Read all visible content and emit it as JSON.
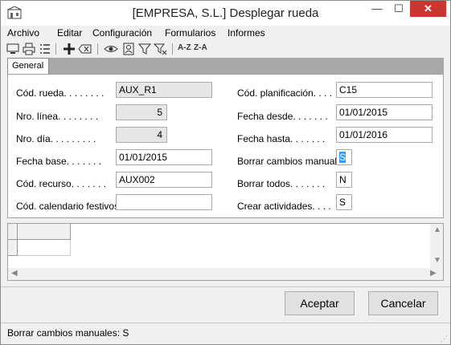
{
  "window": {
    "title": "[EMPRESA, S.L.] Desplegar rueda"
  },
  "titlebar_buttons": {
    "minimize": "—",
    "maximize": "☐",
    "close": "✕"
  },
  "menu": [
    "Archivo",
    "Editar",
    "Configuración",
    "Formularios",
    "Informes"
  ],
  "toolbar": {
    "sort_asc": "A-Z",
    "sort_desc": "Z-A"
  },
  "tabs": [
    "General"
  ],
  "form_left": [
    {
      "label": "Cód. rueda. . . . . . . .",
      "value": "AUX_R1",
      "readonly": true,
      "align": "left"
    },
    {
      "label": "Nro. línea. . . . . . . .",
      "value": "5",
      "readonly": true,
      "align": "right"
    },
    {
      "label": "Nro. día. . . . . . . . .",
      "value": "4",
      "readonly": true,
      "align": "right"
    },
    {
      "label": "Fecha base. . . . . . .",
      "value": "01/01/2015",
      "readonly": false,
      "align": "left"
    },
    {
      "label": "Cód. recurso. . . . . . .",
      "value": "AUX002",
      "readonly": false,
      "align": "left"
    },
    {
      "label": "Cód. calendario festivos.",
      "value": "",
      "readonly": false,
      "align": "left"
    }
  ],
  "form_right": [
    {
      "label": "Cód. planificación. . . .",
      "value": "C15"
    },
    {
      "label": "Fecha desde. . . . . . .",
      "value": "01/01/2015"
    },
    {
      "label": "Fecha hasta. . . . . . .",
      "value": "01/01/2016"
    },
    {
      "label": "Borrar cambios manuales.",
      "value": "S"
    },
    {
      "label": "Borrar todos. . . . . . .",
      "value": "N"
    },
    {
      "label": "Crear actividades. . . .",
      "value": "S"
    }
  ],
  "buttons": {
    "accept": "Aceptar",
    "cancel": "Cancelar"
  },
  "status": "Borrar cambios manuales: S"
}
